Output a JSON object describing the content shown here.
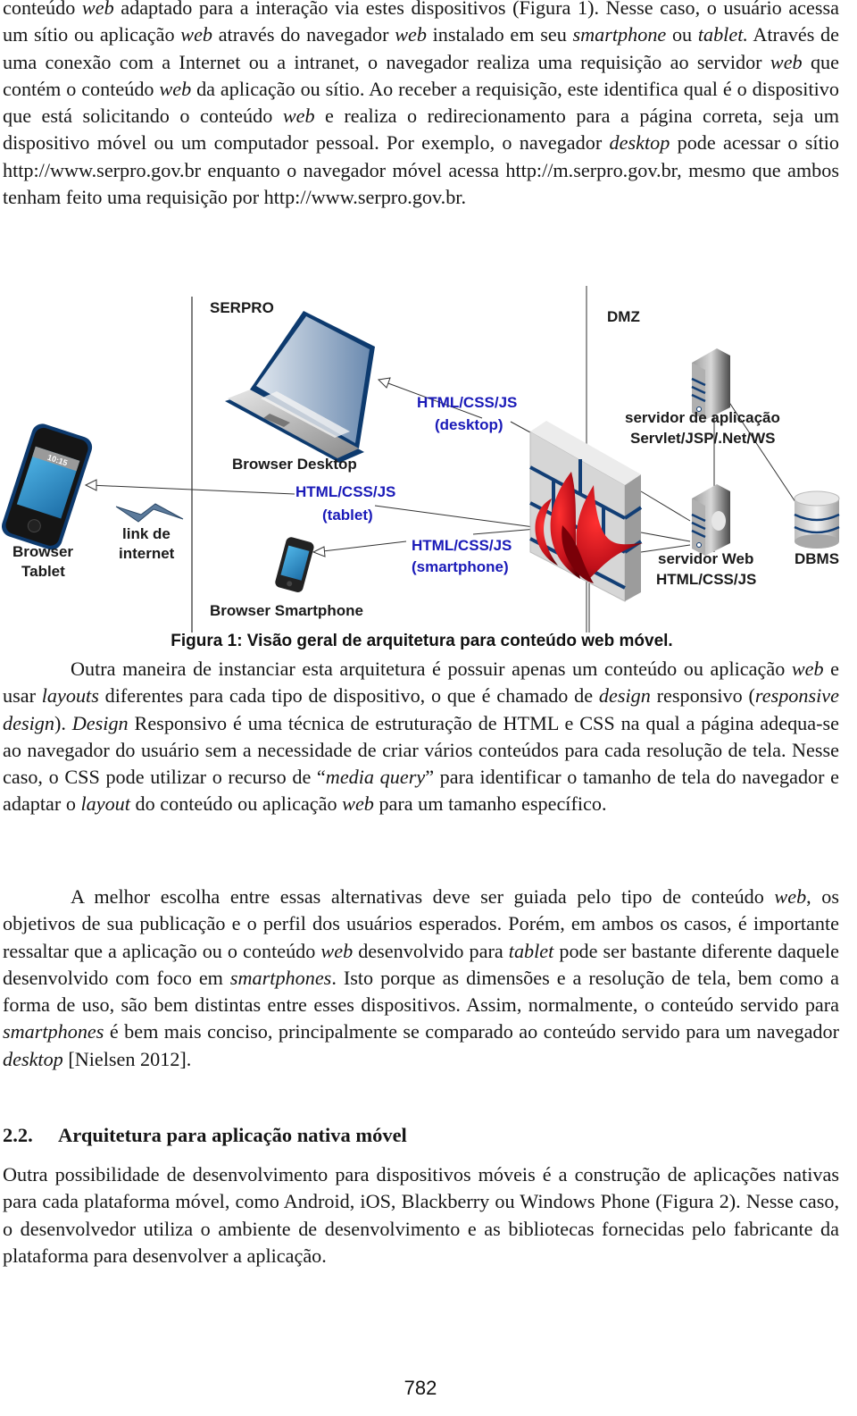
{
  "paragraphs": {
    "p1": [
      {
        "t": "conteúdo "
      },
      {
        "t": "web",
        "i": true
      },
      {
        "t": " adaptado para a interação via estes dispositivos (Figura 1). Nesse caso, o usuário acessa um sítio ou aplicação "
      },
      {
        "t": "web",
        "i": true
      },
      {
        "t": " através do navegador "
      },
      {
        "t": "web",
        "i": true
      },
      {
        "t": " instalado em seu "
      },
      {
        "t": "smartphone",
        "i": true
      },
      {
        "t": " ou "
      },
      {
        "t": "tablet.",
        "i": true
      },
      {
        "t": " Através de uma conexão com a Internet ou a intranet, o navegador realiza uma requisição ao servidor "
      },
      {
        "t": "web",
        "i": true
      },
      {
        "t": " que contém o conteúdo "
      },
      {
        "t": "web",
        "i": true
      },
      {
        "t": " da aplicação ou sítio. Ao receber a requisição, este identifica qual é o dispositivo que está solicitando o conteúdo "
      },
      {
        "t": "web",
        "i": true
      },
      {
        "t": " e realiza o redirecionamento para a página correta, seja um dispositivo móvel ou um computador pessoal. Por exemplo, o navegador "
      },
      {
        "t": "desktop",
        "i": true
      },
      {
        "t": " pode acessar o sítio http://www.serpro.gov.br enquanto o navegador móvel acessa http://m.serpro.gov.br, mesmo que ambos tenham feito uma requisição por http://www.serpro.gov.br."
      }
    ],
    "p2": [
      {
        "t": "Outra maneira de instanciar esta arquitetura é possuir apenas um conteúdo ou aplicação "
      },
      {
        "t": "web",
        "i": true
      },
      {
        "t": " e usar "
      },
      {
        "t": "layouts",
        "i": true
      },
      {
        "t": " diferentes para cada tipo de dispositivo, o que é chamado de "
      },
      {
        "t": "design",
        "i": true
      },
      {
        "t": " responsivo ("
      },
      {
        "t": "responsive design",
        "i": true
      },
      {
        "t": "). "
      },
      {
        "t": "Design",
        "i": true
      },
      {
        "t": " Responsivo é uma técnica de estruturação de HTML e CSS na qual a página adequa-se ao navegador do usuário sem a necessidade de criar vários conteúdos para cada resolução de tela. Nesse caso, o CSS pode utilizar o recurso de “"
      },
      {
        "t": "media query",
        "i": true
      },
      {
        "t": "” para identificar o tamanho de tela do navegador e adaptar o "
      },
      {
        "t": "layout",
        "i": true
      },
      {
        "t": " do conteúdo ou aplicação "
      },
      {
        "t": "web",
        "i": true
      },
      {
        "t": " para um tamanho específico."
      }
    ],
    "p3": [
      {
        "t": "A melhor escolha entre essas alternativas deve ser guiada pelo tipo de conteúdo "
      },
      {
        "t": "web",
        "i": true
      },
      {
        "t": ", os objetivos de sua publicação e o perfil dos usuários esperados. Porém, em ambos os casos, é importante ressaltar que a aplicação ou o conteúdo "
      },
      {
        "t": "web",
        "i": true
      },
      {
        "t": " desenvolvido para "
      },
      {
        "t": "tablet",
        "i": true
      },
      {
        "t": " pode ser bastante diferente daquele desenvolvido com foco em "
      },
      {
        "t": "smartphones",
        "i": true
      },
      {
        "t": ". Isto porque as dimensões e a resolução de tela, bem como a forma de uso, são bem distintas entre esses dispositivos. Assim, normalmente, o conteúdo servido para "
      },
      {
        "t": "smartphones",
        "i": true
      },
      {
        "t": " é bem mais conciso, principalmente se comparado ao conteúdo servido para um navegador "
      },
      {
        "t": "desktop",
        "i": true
      },
      {
        "t": " [Nielsen 2012]."
      }
    ],
    "p4": [
      {
        "t": "Outra possibilidade de desenvolvimento para dispositivos móveis é a construção de aplicações nativas para cada plataforma móvel, como Android, iOS, Blackberry ou Windows Phone (Figura 2). Nesse caso, o desenvolvedor utiliza o ambiente de desenvolvimento e as bibliotecas fornecidas pelo fabricante da plataforma para desenvolver a aplicação."
      }
    ]
  },
  "section": {
    "number": "2.2.",
    "title": "Arquitetura para aplicação nativa móvel"
  },
  "figure": {
    "caption": "Figura 1: Visão geral de arquitetura para conteúdo web móvel.",
    "zones": {
      "serpro": "SERPRO",
      "dmz": "DMZ"
    },
    "tablet": {
      "time": "10:15",
      "label_line1": "Browser",
      "label_line2": "Tablet"
    },
    "link": {
      "line1": "link de",
      "line2": "internet"
    },
    "desktop": {
      "label": "Browser Desktop"
    },
    "smartphone": {
      "label": "Browser Smartphone"
    },
    "flows": {
      "desktop": {
        "line1": "HTML/CSS/JS",
        "line2": "(desktop)"
      },
      "tablet": {
        "line1": "HTML/CSS/JS",
        "line2": "(tablet)"
      },
      "smartphone": {
        "line1": "HTML/CSS/JS",
        "line2": "(smartphone)"
      }
    },
    "app_server": {
      "line1": "servidor de aplicação",
      "line2": "Servlet/JSP/.Net/WS"
    },
    "web_server": {
      "line1": "servidor Web",
      "line2": "HTML/CSS/JS"
    },
    "dbms": {
      "label": "DBMS"
    },
    "colors": {
      "flow_label": "#1a1ab8",
      "device_blue": "#0d3a6e",
      "flame_red": "#c0101a"
    }
  },
  "page_number": "782"
}
